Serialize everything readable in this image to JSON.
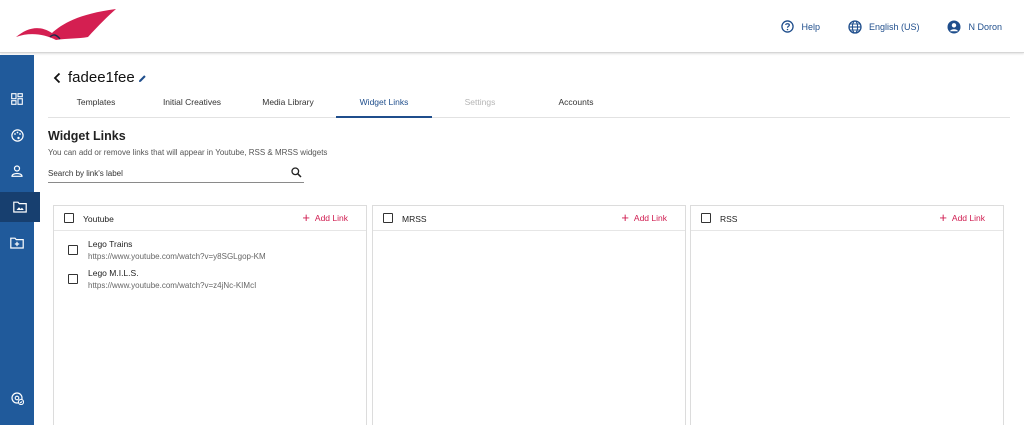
{
  "header": {
    "help_label": "Help",
    "language_label": "English (US)",
    "user_label": "N Doron"
  },
  "colors": {
    "primary": "#1f4e8c",
    "sidebar": "#205a9b",
    "sidebar_active": "#173f6f",
    "accent": "#d01c50"
  },
  "sidebar": {
    "items": [
      {
        "icon": "dashboard-icon",
        "active": false
      },
      {
        "icon": "palette-icon",
        "active": false
      },
      {
        "icon": "user-icon",
        "active": false
      },
      {
        "icon": "folder-image-icon",
        "active": true
      },
      {
        "icon": "folder-add-icon",
        "active": false
      },
      {
        "icon": "settings-icon",
        "active": false
      }
    ]
  },
  "project": {
    "name": "fadee1fee"
  },
  "tabs": [
    {
      "label": "Templates",
      "state": "normal"
    },
    {
      "label": "Initial Creatives",
      "state": "normal"
    },
    {
      "label": "Media Library",
      "state": "normal"
    },
    {
      "label": "Widget Links",
      "state": "active"
    },
    {
      "label": "Settings",
      "state": "disabled"
    },
    {
      "label": "Accounts",
      "state": "normal"
    }
  ],
  "section": {
    "title": "Widget Links",
    "description": "You can add or remove links that will appear in Youtube, RSS & MRSS widgets"
  },
  "search": {
    "placeholder": "Search by link's label",
    "value": ""
  },
  "columns": [
    {
      "title": "Youtube",
      "add_label": "Add Link",
      "links": [
        {
          "label": "Lego Trains",
          "url": "https://www.youtube.com/watch?v=y8SGLgop-KM"
        },
        {
          "label": "Lego M.I.L.S.",
          "url": "https://www.youtube.com/watch?v=z4jNc-KIMcI"
        }
      ]
    },
    {
      "title": "MRSS",
      "add_label": "Add Link",
      "links": []
    },
    {
      "title": "RSS",
      "add_label": "Add Link",
      "links": []
    }
  ]
}
